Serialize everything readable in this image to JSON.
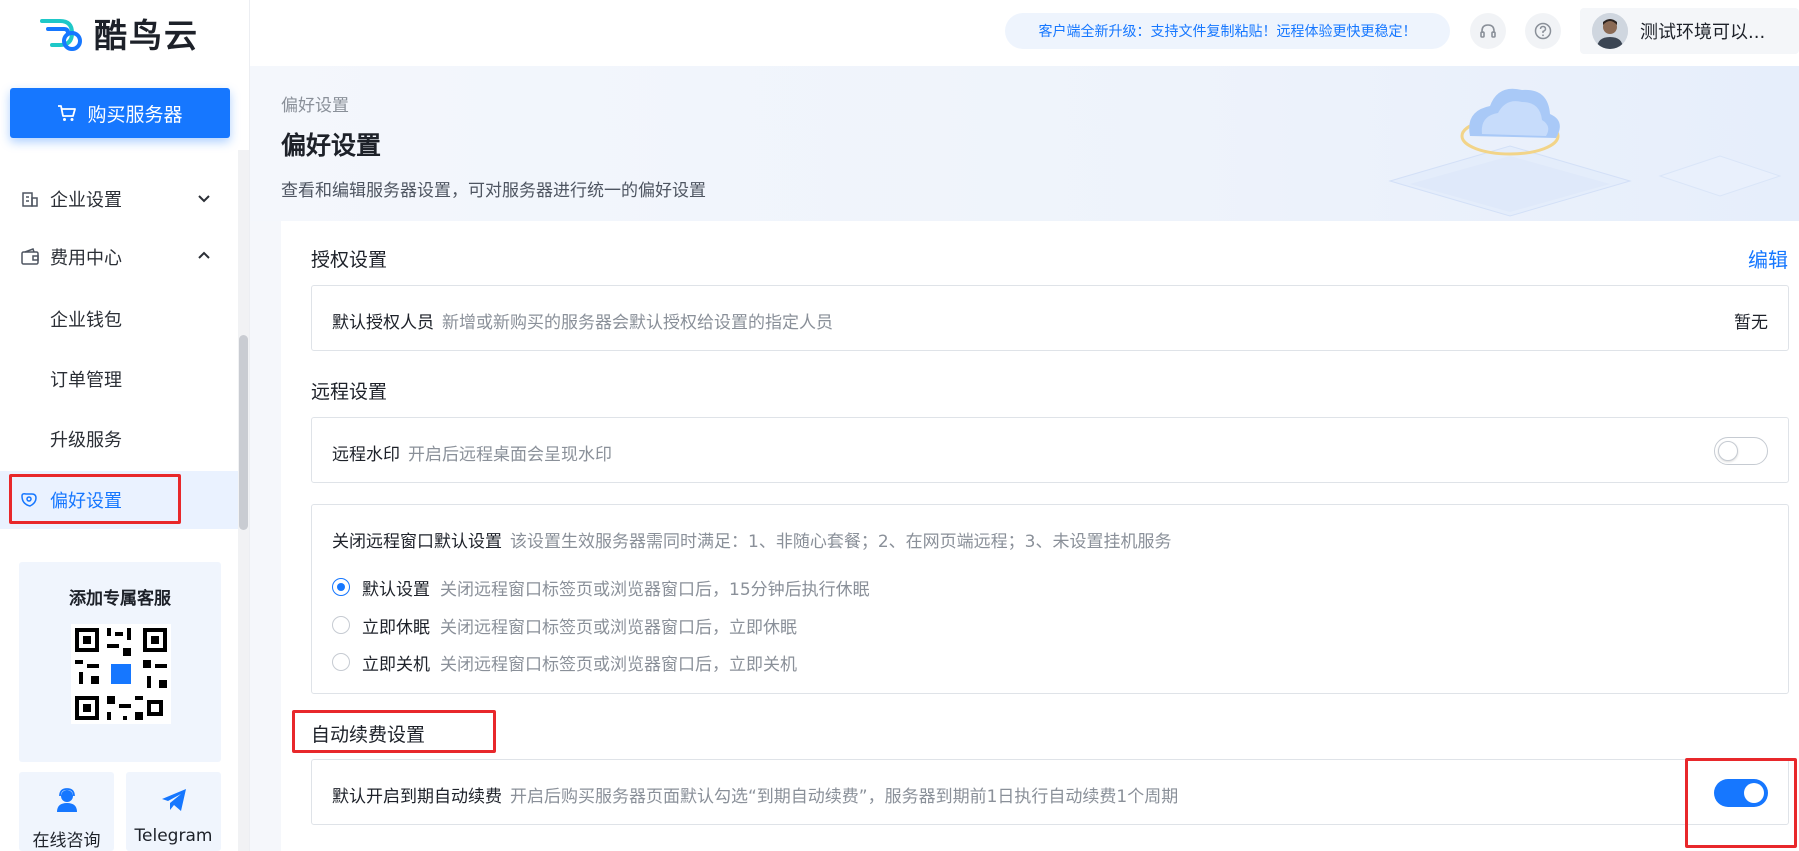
{
  "app": {
    "logo_text": "酷鸟云"
  },
  "sidebar": {
    "buy_button": "购买服务器",
    "items": [
      {
        "label": "企业设置"
      },
      {
        "label": "费用中心"
      }
    ],
    "sub_items": [
      {
        "label": "企业钱包"
      },
      {
        "label": "订单管理"
      },
      {
        "label": "升级服务"
      },
      {
        "label": "偏好设置"
      }
    ],
    "service_card": {
      "title": "添加专属客服"
    },
    "contacts": [
      {
        "label": "在线咨询"
      },
      {
        "label": "Telegram"
      }
    ]
  },
  "topbar": {
    "notice": "客户端全新升级：支持文件复制粘贴！远程体验更快更稳定！",
    "user_name": "测试环境可以..."
  },
  "page": {
    "breadcrumb": "偏好设置",
    "title": "偏好设置",
    "description": "查看和编辑服务器设置，可对服务器进行统一的偏好设置"
  },
  "auth_settings": {
    "title": "授权设置",
    "edit_label": "编辑",
    "default_user_label": "默认授权人员",
    "default_user_hint": "新增或新购买的服务器会默认授权给设置的指定人员",
    "default_user_value": "暂无"
  },
  "remote_settings": {
    "title": "远程设置",
    "watermark_label": "远程水印",
    "watermark_hint": "开启后远程桌面会呈现水印",
    "watermark_enabled": false,
    "close_window_label": "关闭远程窗口默认设置",
    "close_window_hint": "该设置生效服务器需同时满足：1、非随心套餐；2、在网页端远程；3、未设置挂机服务",
    "options": [
      {
        "label": "默认设置",
        "hint": "关闭远程窗口标签页或浏览器窗口后，15分钟后执行休眠",
        "checked": true
      },
      {
        "label": "立即休眠",
        "hint": "关闭远程窗口标签页或浏览器窗口后，立即休眠",
        "checked": false
      },
      {
        "label": "立即关机",
        "hint": "关闭远程窗口标签页或浏览器窗口后，立即关机",
        "checked": false
      }
    ]
  },
  "renew_settings": {
    "title": "自动续费设置",
    "auto_renew_label": "默认开启到期自动续费",
    "auto_renew_hint": "开启后购买服务器页面默认勾选“到期自动续费”，服务器到期前1日执行自动续费1个周期",
    "auto_renew_enabled": true
  },
  "colors": {
    "accent": "#1677ff",
    "highlight": "#e8282b"
  }
}
